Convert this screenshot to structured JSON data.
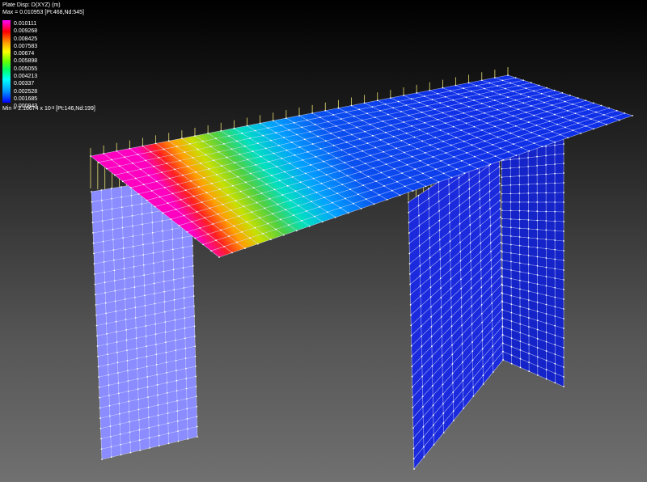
{
  "legend": {
    "title": "Plate Disp: D(XYZ) (m)",
    "max": "Max = 0.010953 [Pt:468,Nd:545]",
    "values": [
      "0.010111",
      "0.009268",
      "0.008425",
      "0.007583",
      "0.00674",
      "0.005898",
      "0.005055",
      "0.004213",
      "0.00337",
      "0.002528",
      "0.001685",
      "0.000843"
    ],
    "min_prefix": "Min = 2.16674 x 10",
    "min_exp": "-9",
    "min_suffix": " [Pt:146,Nd:199]",
    "colors": [
      "#ff00ff",
      "#ff0000",
      "#ff9900",
      "#ffff00",
      "#66ff00",
      "#00ff66",
      "#00ffff",
      "#0099ff",
      "#0000ff"
    ]
  },
  "model": {
    "colors": {
      "low_disp": "#1030e8",
      "left_wall": "#8a8cff",
      "right_wall_front": "#1a2adc",
      "right_wall_side": "#1424c8",
      "mesh_line": "#d8ddff",
      "support": "#e8e070"
    }
  }
}
